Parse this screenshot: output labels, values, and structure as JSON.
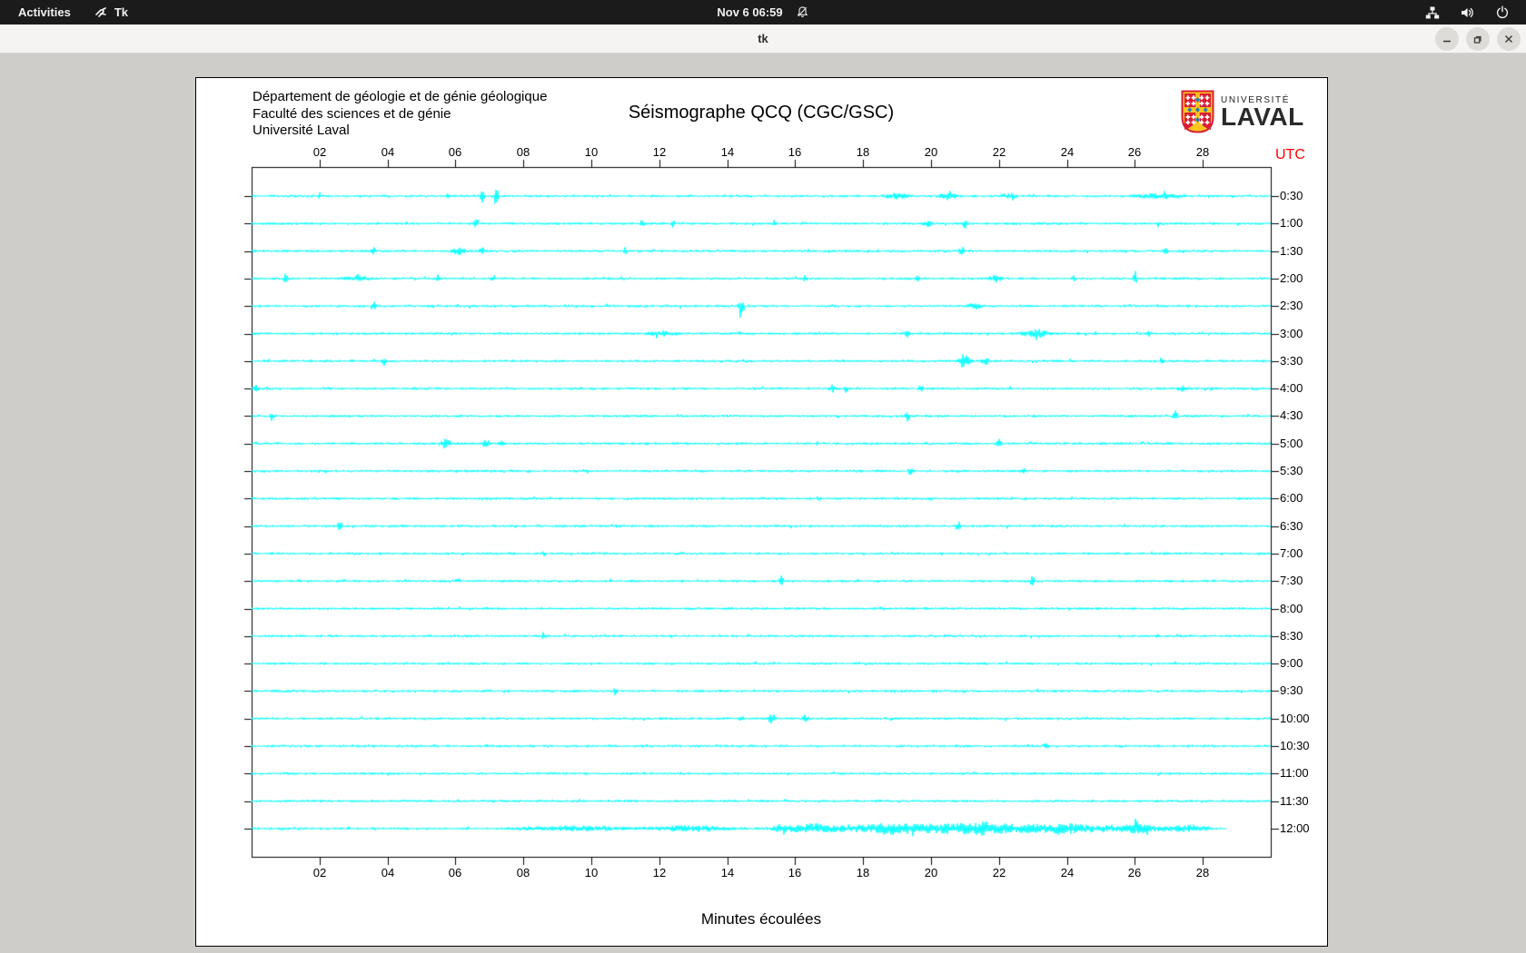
{
  "top_bar": {
    "activities_label": "Activities",
    "app_indicator_label": "Tk",
    "clock": "Nov 6  06:59",
    "icons": [
      "tk-app-icon",
      "notifications-disabled-bell-icon",
      "wired-network-icon",
      "volume-icon",
      "power-icon"
    ]
  },
  "window": {
    "title": "tk",
    "buttons": [
      "minimize",
      "maximize",
      "close"
    ]
  },
  "seismograph": {
    "header_lines": [
      "Département de géologie et de génie géologique",
      "Faculté des sciences et de génie",
      "Université Laval"
    ],
    "title": "Séismographe QCQ (CGC/GSC)",
    "logo": {
      "top": "UNIVERSITÉ",
      "bottom": "LAVAL"
    },
    "utc_label": "UTC",
    "utc_color": "#ff0000",
    "trace_color": "#00ffff",
    "xlabel": "Minutes écoulées",
    "x_ticks": [
      "02",
      "04",
      "06",
      "08",
      "10",
      "12",
      "14",
      "16",
      "18",
      "20",
      "22",
      "24",
      "26",
      "28"
    ],
    "minutes_span": 30,
    "rows": [
      {
        "utc": "0:30",
        "events": [
          [
            2.0,
            3,
            0.07
          ],
          [
            5.8,
            5,
            0.07
          ],
          [
            6.8,
            11,
            0.09
          ],
          [
            7.2,
            12,
            0.09
          ],
          [
            19.0,
            3,
            0.5
          ],
          [
            20.5,
            4,
            0.4
          ],
          [
            22.3,
            3,
            0.3
          ],
          [
            26.7,
            2.5,
            0.9
          ]
        ]
      },
      {
        "utc": "1:00",
        "events": [
          [
            6.6,
            10,
            0.09
          ],
          [
            11.5,
            6,
            0.07
          ],
          [
            12.4,
            5,
            0.07
          ],
          [
            15.4,
            4,
            0.07
          ],
          [
            19.9,
            3,
            0.2
          ],
          [
            21.0,
            5,
            0.12
          ],
          [
            26.7,
            4,
            0.09
          ]
        ]
      },
      {
        "utc": "1:30",
        "events": [
          [
            3.6,
            5,
            0.08
          ],
          [
            6.1,
            4,
            0.3
          ],
          [
            6.8,
            5,
            0.09
          ],
          [
            11.0,
            4,
            0.09
          ],
          [
            20.9,
            5,
            0.1
          ],
          [
            26.9,
            5,
            0.09
          ]
        ]
      },
      {
        "utc": "2:00",
        "events": [
          [
            1.0,
            5,
            0.08
          ],
          [
            3.1,
            3,
            0.5
          ],
          [
            5.5,
            4,
            0.09
          ],
          [
            7.1,
            5,
            0.08
          ],
          [
            16.3,
            5,
            0.08
          ],
          [
            19.6,
            6,
            0.09
          ],
          [
            21.9,
            4,
            0.25
          ],
          [
            24.2,
            3,
            0.1
          ],
          [
            26.0,
            4,
            0.09
          ]
        ]
      },
      {
        "utc": "2:30",
        "events": [
          [
            3.6,
            6,
            0.09
          ],
          [
            14.4,
            8,
            0.12
          ],
          [
            21.3,
            3,
            0.3
          ]
        ]
      },
      {
        "utc": "3:00",
        "events": [
          [
            12.1,
            2.5,
            0.6
          ],
          [
            19.3,
            5,
            0.09
          ],
          [
            23.1,
            4,
            0.6
          ],
          [
            26.4,
            3,
            0.1
          ]
        ]
      },
      {
        "utc": "3:30",
        "events": [
          [
            3.9,
            5,
            0.09
          ],
          [
            21.0,
            6,
            0.25
          ],
          [
            21.6,
            5,
            0.15
          ],
          [
            26.8,
            4,
            0.09
          ]
        ]
      },
      {
        "utc": "4:00",
        "events": [
          [
            0.15,
            7,
            0.09
          ],
          [
            17.1,
            4,
            0.12
          ],
          [
            17.5,
            4,
            0.09
          ],
          [
            19.7,
            4,
            0.09
          ],
          [
            27.4,
            2.5,
            0.2
          ]
        ]
      },
      {
        "utc": "4:30",
        "events": [
          [
            0.6,
            5,
            0.09
          ],
          [
            19.3,
            5,
            0.09
          ],
          [
            27.2,
            8,
            0.09
          ]
        ]
      },
      {
        "utc": "5:00",
        "events": [
          [
            5.7,
            5,
            0.2
          ],
          [
            6.9,
            6,
            0.15
          ],
          [
            7.4,
            5,
            0.12
          ],
          [
            22.0,
            5,
            0.09
          ]
        ]
      },
      {
        "utc": "5:30",
        "events": [
          [
            19.4,
            5,
            0.09
          ],
          [
            22.7,
            4,
            0.09
          ]
        ]
      },
      {
        "utc": "6:00",
        "events": [
          [
            16.7,
            1.5,
            0.1
          ]
        ]
      },
      {
        "utc": "6:30",
        "events": [
          [
            2.6,
            8,
            0.09
          ],
          [
            20.8,
            7,
            0.09
          ]
        ]
      },
      {
        "utc": "7:00",
        "events": [
          [
            8.6,
            2.5,
            0.08
          ]
        ]
      },
      {
        "utc": "7:30",
        "events": [
          [
            15.6,
            7,
            0.09
          ],
          [
            23.0,
            7,
            0.09
          ]
        ]
      },
      {
        "utc": "8:00",
        "events": []
      },
      {
        "utc": "8:30",
        "events": [
          [
            8.6,
            4,
            0.09
          ]
        ]
      },
      {
        "utc": "9:00",
        "events": []
      },
      {
        "utc": "9:30",
        "events": [
          [
            10.7,
            4.5,
            0.09
          ]
        ]
      },
      {
        "utc": "10:00",
        "events": [
          [
            14.4,
            3,
            0.12
          ],
          [
            15.3,
            5,
            0.15
          ],
          [
            16.3,
            4,
            0.12
          ]
        ]
      },
      {
        "utc": "10:30",
        "events": [
          [
            23.4,
            4,
            0.09
          ]
        ]
      },
      {
        "utc": "11:00",
        "events": []
      },
      {
        "utc": "11:30",
        "events": []
      },
      {
        "utc": "12:00",
        "end_minute": 28.7,
        "events": [
          [
            3.6,
            2,
            0.08
          ],
          [
            9.5,
            2.5,
            2.5
          ],
          [
            13,
            3,
            1.5
          ],
          [
            15.5,
            4,
            0.1
          ],
          [
            16.5,
            5,
            1.5
          ],
          [
            19,
            6,
            1.8
          ],
          [
            21.5,
            7,
            2.0
          ],
          [
            24,
            6,
            1.5
          ],
          [
            26,
            5,
            1.2
          ],
          [
            27.5,
            4,
            0.8
          ]
        ]
      }
    ]
  }
}
